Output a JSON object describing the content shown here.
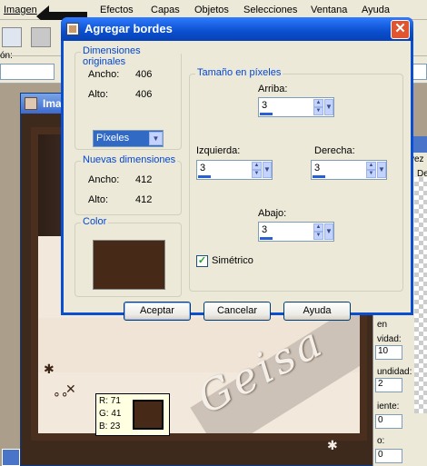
{
  "app": {
    "menu": [
      "Imagen",
      "Efectos",
      "Capas",
      "Objetos",
      "Selecciones",
      "Ventana",
      "Ayuda"
    ],
    "toolbar_label": "ón:",
    "image_window_title": "Imag",
    "right_panel": {
      "col_header": "De",
      "labels": [
        "en",
        "vidad:",
        "undidad:",
        "iente:",
        "o:"
      ],
      "values": [
        "10",
        "2",
        "0",
        "0"
      ],
      "tab_label": "vez"
    },
    "watermark": "Geisa",
    "color_info": {
      "r": "R: 71",
      "g": "G: 41",
      "b": "B: 23",
      "swatch_color": "#472917"
    }
  },
  "dialog": {
    "title": "Agregar bordes",
    "original": {
      "group_title": "Dimensiones originales",
      "width_label": "Ancho:",
      "width_value": "406",
      "height_label": "Alto:",
      "height_value": "406"
    },
    "unit_select": "Píxeles",
    "new": {
      "group_title": "Nuevas dimensiones",
      "width_label": "Ancho:",
      "width_value": "412",
      "height_label": "Alto:",
      "height_value": "412"
    },
    "color": {
      "group_title": "Color",
      "value": "#472917"
    },
    "size": {
      "group_title": "Tamaño en píxeles",
      "top_label": "Arriba:",
      "top_value": "3",
      "left_label": "Izquierda:",
      "left_value": "3",
      "right_label": "Derecha:",
      "right_value": "3",
      "bottom_label": "Abajo:",
      "bottom_value": "3",
      "symmetric_label": "Simétrico",
      "symmetric_checked": true
    },
    "buttons": {
      "ok": "Aceptar",
      "cancel": "Cancelar",
      "help": "Ayuda"
    }
  }
}
